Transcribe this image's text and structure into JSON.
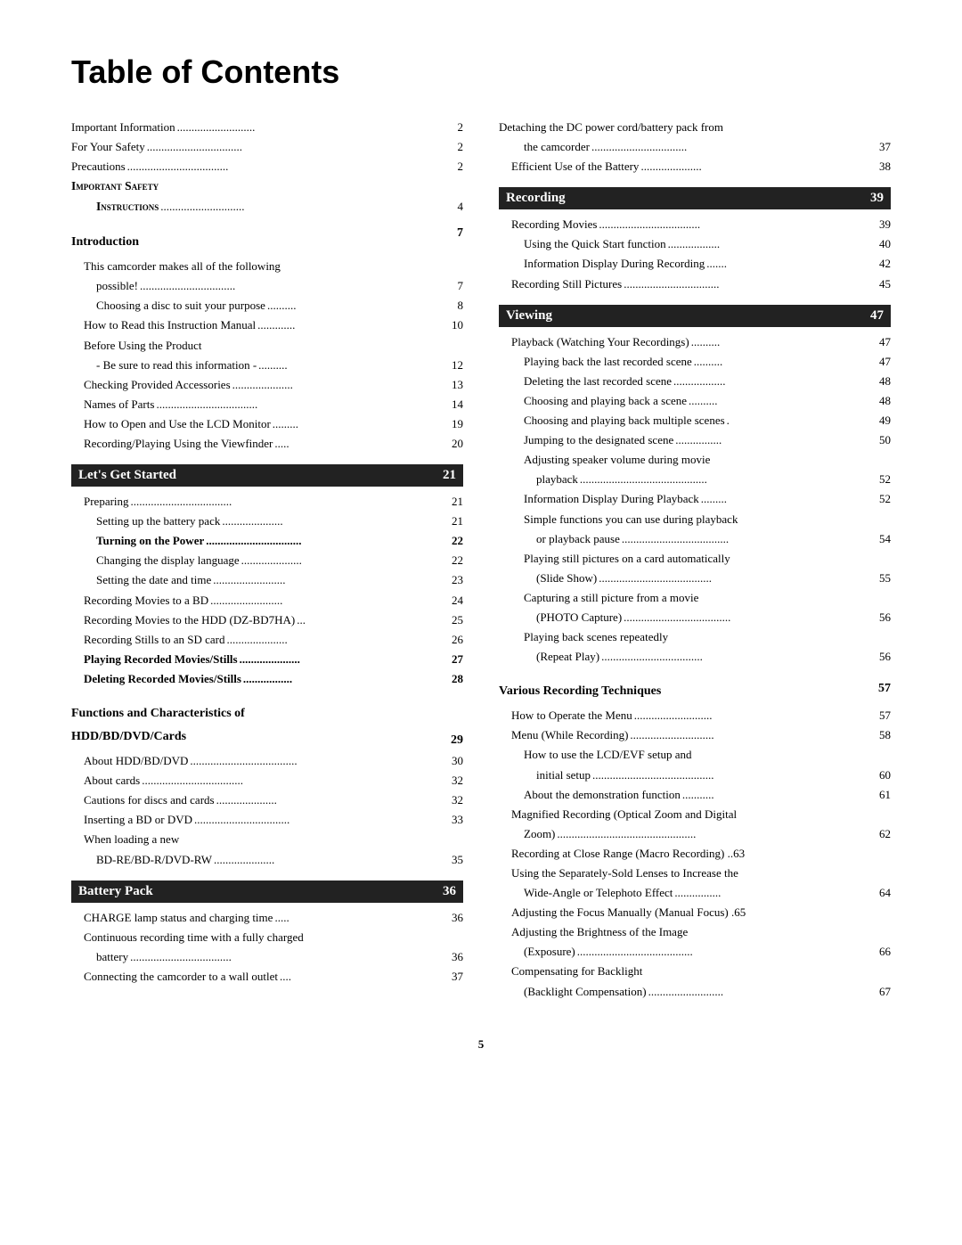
{
  "title": "Table of Contents",
  "page_number": "5",
  "left_col": {
    "top_entries": [
      {
        "label": "Important Information",
        "dots": true,
        "page": "2",
        "indent": 0
      },
      {
        "label": "For Your Safety",
        "dots": true,
        "page": "2",
        "indent": 0
      },
      {
        "label": "Precautions",
        "dots": true,
        "page": "2",
        "indent": 0
      },
      {
        "label": "IMPORTANT SAFETY",
        "dots": false,
        "page": "",
        "indent": 0,
        "small_caps": true
      },
      {
        "label": "INSTRUCTIONS",
        "dots": true,
        "page": "4",
        "indent": 2,
        "small_caps": true
      }
    ],
    "introduction": {
      "header": "Introduction",
      "page": "7",
      "entries": [
        {
          "label": "This camcorder makes all of the following",
          "dots": false,
          "page": "",
          "indent": 1
        },
        {
          "label": "possible!",
          "dots": true,
          "page": "7",
          "indent": 2
        },
        {
          "label": "Choosing a disc to suit your purpose",
          "dots": true,
          "page": "8",
          "indent": 2
        },
        {
          "label": "How to Read this Instruction Manual",
          "dots": true,
          "page": "10",
          "indent": 1
        },
        {
          "label": "Before Using the Product",
          "dots": false,
          "page": "",
          "indent": 1
        },
        {
          "label": "- Be sure to read this information -",
          "dots": true,
          "page": "12",
          "indent": 2
        },
        {
          "label": "Checking Provided Accessories",
          "dots": true,
          "page": "13",
          "indent": 1
        },
        {
          "label": "Names of Parts",
          "dots": true,
          "page": "14",
          "indent": 1
        },
        {
          "label": "How to Open and Use the LCD Monitor",
          "dots": true,
          "page": "19",
          "indent": 1
        },
        {
          "label": "Recording/Playing Using the Viewfinder",
          "dots": true,
          "page": "20",
          "indent": 1
        }
      ]
    },
    "lets_get_started": {
      "header": "Let’s Get Started",
      "page": "21",
      "entries": [
        {
          "label": "Preparing",
          "dots": true,
          "page": "21",
          "indent": 1
        },
        {
          "label": "Setting up the battery pack",
          "dots": true,
          "page": "21",
          "indent": 2
        },
        {
          "label": "Turning on the Power",
          "dots": true,
          "page": "22",
          "indent": 2,
          "bold": true
        },
        {
          "label": "Changing the display language",
          "dots": true,
          "page": "22",
          "indent": 2
        },
        {
          "label": "Setting the date and time",
          "dots": true,
          "page": "23",
          "indent": 2
        },
        {
          "label": "Recording Movies to a BD",
          "dots": true,
          "page": "24",
          "indent": 1
        },
        {
          "label": "Recording Movies to the HDD (DZ-BD7HA)",
          "dots": true,
          "page": "25",
          "indent": 1
        },
        {
          "label": "Recording Stills to an SD card",
          "dots": true,
          "page": "26",
          "indent": 1
        },
        {
          "label": "Playing Recorded Movies/Stills",
          "dots": true,
          "page": "27",
          "indent": 1,
          "bold": true
        },
        {
          "label": "Deleting Recorded Movies/Stills",
          "dots": true,
          "page": "28",
          "indent": 1,
          "bold": true
        }
      ]
    },
    "functions": {
      "header": "Functions and Characteristics of",
      "header2": "HDD/BD/DVD/Cards",
      "page": "29",
      "entries": [
        {
          "label": "About HDD/BD/DVD",
          "dots": true,
          "page": "30",
          "indent": 1
        },
        {
          "label": "About cards",
          "dots": true,
          "page": "32",
          "indent": 1
        },
        {
          "label": "Cautions for discs and cards",
          "dots": true,
          "page": "32",
          "indent": 1
        },
        {
          "label": "Inserting a BD or DVD",
          "dots": true,
          "page": "33",
          "indent": 1
        },
        {
          "label": "When loading a new",
          "dots": false,
          "page": "",
          "indent": 1
        },
        {
          "label": "BD-RE/BD-R/DVD-RW",
          "dots": true,
          "page": "35",
          "indent": 2
        }
      ]
    },
    "battery_pack": {
      "header": "Battery Pack",
      "page": "36",
      "entries": [
        {
          "label": "CHARGE lamp status and charging time",
          "dots": true,
          "page": "36",
          "indent": 1
        },
        {
          "label": "Continuous recording time with a fully charged",
          "dots": false,
          "page": "",
          "indent": 1
        },
        {
          "label": "battery",
          "dots": true,
          "page": "36",
          "indent": 2
        },
        {
          "label": "Connecting the camcorder to a wall outlet",
          "dots": true,
          "page": "37",
          "indent": 1
        }
      ]
    }
  },
  "right_col": {
    "top_entries": [
      {
        "label": "Detaching the DC power cord/battery pack from",
        "dots": false,
        "page": "",
        "indent": 0
      },
      {
        "label": "the camcorder",
        "dots": true,
        "page": "37",
        "indent": 2
      },
      {
        "label": "Efficient Use of the Battery",
        "dots": true,
        "page": "38",
        "indent": 1
      }
    ],
    "recording": {
      "header": "Recording",
      "page": "39",
      "entries": [
        {
          "label": "Recording Movies",
          "dots": true,
          "page": "39",
          "indent": 1
        },
        {
          "label": "Using the Quick Start function",
          "dots": true,
          "page": "40",
          "indent": 2
        },
        {
          "label": "Information Display During Recording",
          "dots": true,
          "page": "42",
          "indent": 2
        },
        {
          "label": "Recording Still Pictures",
          "dots": true,
          "page": "45",
          "indent": 1
        }
      ]
    },
    "viewing": {
      "header": "Viewing",
      "page": "47",
      "entries": [
        {
          "label": "Playback (Watching Your Recordings)",
          "dots": true,
          "page": "47",
          "indent": 1
        },
        {
          "label": "Playing back the last recorded scene",
          "dots": true,
          "page": "47",
          "indent": 2
        },
        {
          "label": "Deleting the last recorded scene",
          "dots": true,
          "page": "48",
          "indent": 2
        },
        {
          "label": "Choosing and playing back a scene",
          "dots": true,
          "page": "48",
          "indent": 2
        },
        {
          "label": "Choosing and playing back multiple scenes",
          "dots": true,
          "page": "49",
          "indent": 2
        },
        {
          "label": "Jumping to the designated scene",
          "dots": true,
          "page": "50",
          "indent": 2
        },
        {
          "label": "Adjusting speaker volume during movie",
          "dots": false,
          "page": "",
          "indent": 2
        },
        {
          "label": "playback",
          "dots": true,
          "page": "52",
          "indent": 3
        },
        {
          "label": "Information Display During Playback",
          "dots": true,
          "page": "52",
          "indent": 2
        },
        {
          "label": "Simple functions you can use during playback",
          "dots": false,
          "page": "",
          "indent": 2
        },
        {
          "label": "or playback pause",
          "dots": true,
          "page": "54",
          "indent": 3
        },
        {
          "label": "Playing still pictures on a card automatically",
          "dots": false,
          "page": "",
          "indent": 2
        },
        {
          "label": "(Slide Show)",
          "dots": true,
          "page": "55",
          "indent": 3
        },
        {
          "label": "Capturing a still picture from a movie",
          "dots": false,
          "page": "",
          "indent": 2
        },
        {
          "label": "(PHOTO Capture)",
          "dots": true,
          "page": "56",
          "indent": 3
        },
        {
          "label": "Playing back scenes repeatedly",
          "dots": false,
          "page": "",
          "indent": 2
        },
        {
          "label": "(Repeat Play)",
          "dots": true,
          "page": "56",
          "indent": 3
        }
      ]
    },
    "various": {
      "header": "Various Recording Techniques",
      "page": "57",
      "entries": [
        {
          "label": "How to Operate the Menu",
          "dots": true,
          "page": "57",
          "indent": 1
        },
        {
          "label": "Menu (While Recording)",
          "dots": true,
          "page": "58",
          "indent": 1
        },
        {
          "label": "How to use the LCD/EVF setup and",
          "dots": false,
          "page": "",
          "indent": 2
        },
        {
          "label": "initial setup",
          "dots": true,
          "page": "60",
          "indent": 3
        },
        {
          "label": "About the demonstration function",
          "dots": true,
          "page": "61",
          "indent": 2
        },
        {
          "label": "Magnified Recording (Optical Zoom and Digital",
          "dots": false,
          "page": "",
          "indent": 1
        },
        {
          "label": "Zoom)",
          "dots": true,
          "page": "62",
          "indent": 2
        },
        {
          "label": "Recording at Close Range (Macro Recording)",
          "dots": true,
          "page": "63",
          "indent": 1
        },
        {
          "label": "Using the Separately-Sold Lenses to Increase the",
          "dots": false,
          "page": "",
          "indent": 1
        },
        {
          "label": "Wide-Angle or Telephoto Effect",
          "dots": true,
          "page": "64",
          "indent": 2
        },
        {
          "label": "Adjusting the Focus Manually (Manual Focus)",
          "dots": true,
          "page": "65",
          "indent": 1
        },
        {
          "label": "Adjusting the Brightness of the Image",
          "dots": false,
          "page": "",
          "indent": 1
        },
        {
          "label": "(Exposure)",
          "dots": true,
          "page": "66",
          "indent": 2
        },
        {
          "label": "Compensating for Backlight",
          "dots": false,
          "page": "",
          "indent": 1
        },
        {
          "label": "(Backlight Compensation)",
          "dots": true,
          "page": "67",
          "indent": 2
        }
      ]
    }
  }
}
